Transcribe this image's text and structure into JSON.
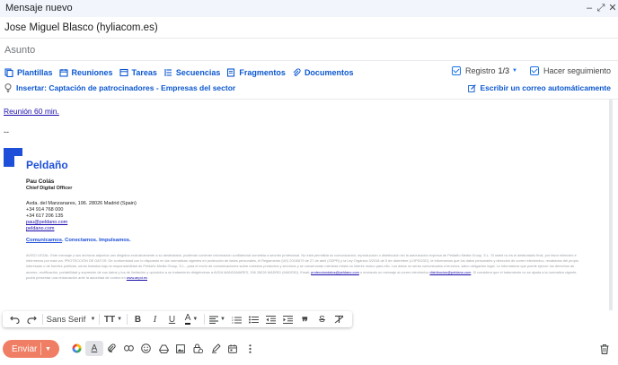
{
  "window": {
    "title": "Mensaje nuevo",
    "minimize_glyph": "‒",
    "expand_glyph": "⤢",
    "close_glyph": "✕"
  },
  "to": {
    "value": "Jose Miguel Blasco (hyliacom.es)"
  },
  "subject": {
    "placeholder": "Asunto"
  },
  "toolbar": {
    "items": [
      {
        "label": "Plantillas",
        "icon": "template-icon"
      },
      {
        "label": "Reuniones",
        "icon": "calendar-icon"
      },
      {
        "label": "Tareas",
        "icon": "task-icon"
      },
      {
        "label": "Secuencias",
        "icon": "sequence-icon"
      },
      {
        "label": "Fragmentos",
        "icon": "snippet-icon"
      },
      {
        "label": "Documentos",
        "icon": "attachment-icon"
      }
    ],
    "registro": "Registro",
    "registro_count": "1/3",
    "seguimiento": "Hacer seguimiento",
    "insert_label": "Insertar: Captación de patrocinadores - Empresas del sector",
    "auto_email": "Escribir un correo automáticamente"
  },
  "body": {
    "meeting_link": "Reunión 60 min.",
    "separator": "--",
    "logo_text": "Peldaño",
    "signature": {
      "name": "Pau Colás",
      "role": "Chief Digital Officer",
      "address": "Avda. del Manzanares, 196. 28026 Madrid (Spain)",
      "phone1": "+34 914 768 000",
      "phone2": "+34 617 206 135",
      "email": "pau@peldano.com",
      "web": "peldano.com",
      "tagline_link": "Comunicamos",
      "tagline_rest": ". Conectamos. Impulsamos."
    },
    "legal_intro": "AVISO LEGAL: Este mensaje y sus archivos adjuntos van dirigidos exclusivamente a su destinatario, pudiendo contener información confidencial sometida a secreto profesional. No está permitida su comunicación, reproducción o distribución sin la autorización expresa de Peldaño Media Group, S.L. Si usted no es el destinatario final, por favor elimínelo e infórmenos por esta vía. PROTECCIÓN DE DATOS: De conformidad con lo dispuesto en las normativas vigentes en protección de datos personales, el Reglamento (UE) 2016/679 de 27 de abril (GDPR) y la Ley Orgánica 3/2018 de 5 de diciembre (LOPDGDD), le informamos que los datos personales y dirección de correo electrónico, recabados del propio interesado o de fuentes públicas, serán tratados bajo la responsabilidad de Peldaño Media Group, S.L., para el envío de comunicaciones sobre nuestros productos y servicios y se conservarán mientras exista un interés mutuo para ello. Los datos no serán comunicados a terceros, salvo obligación legal. Le informamos que puede ejercer los derechos de acceso, rectificación, portabilidad y supresión de sus datos y los de limitación y oposición a su tratamiento dirigiéndose a AVDA MANZANARES, 196 28026 MADRID (MADRID). Email:",
    "legal_email1": "protecciondatos@peldano.com",
    "legal_mid": "o enviando un mensaje al correo electrónico",
    "legal_email2": "distribucion@peldano.com",
    "legal_end": "Si considera que el tratamiento no se ajusta a la normativa vigente, podrá presentar una reclamación ante la autoridad de control en",
    "legal_link3": "www.aepd.es"
  },
  "format_bar": {
    "font": "Sans Serif",
    "size_glyph": "TT",
    "bold": "B",
    "italic": "I",
    "underline": "U",
    "text_color": "A",
    "strike": "S"
  },
  "bottom": {
    "send_label": "Enviar"
  },
  "colors": {
    "accent_blue": "#0b57d0",
    "send_button": "#ef7e64",
    "brand": "#1e4fd8",
    "titlebar": "#f2f6fc"
  }
}
